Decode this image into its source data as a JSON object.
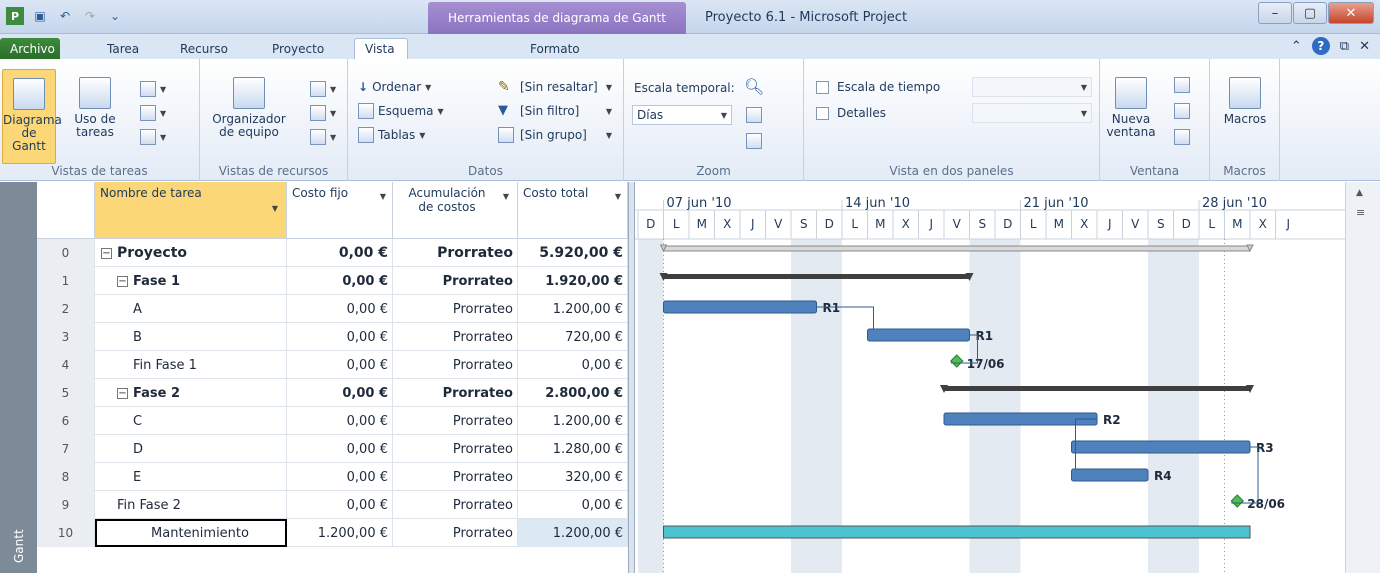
{
  "window": {
    "context_tab": "Herramientas de diagrama de Gantt",
    "title": "Proyecto 6.1  -  Microsoft Project"
  },
  "tabs": [
    {
      "label": "Archivo"
    },
    {
      "label": "Tarea"
    },
    {
      "label": "Recurso"
    },
    {
      "label": "Proyecto"
    },
    {
      "label": "Vista"
    },
    {
      "label": "Formato"
    }
  ],
  "ribbon": {
    "vistas_tareas": {
      "gantt": "Diagrama de Gantt",
      "uso": "Uso de tareas",
      "label": "Vistas de tareas"
    },
    "vistas_recursos": {
      "organizador": "Organizador de equipo",
      "label": "Vistas de recursos"
    },
    "datos": {
      "ordenar": "Ordenar",
      "esquema": "Esquema",
      "tablas": "Tablas",
      "resaltar": "[Sin resaltar]",
      "filtro": "[Sin filtro]",
      "grupo": "[Sin grupo]",
      "label": "Datos"
    },
    "zoom": {
      "escala_label": "Escala temporal:",
      "escala_value": "Días",
      "label": "Zoom"
    },
    "dos_paneles": {
      "escala_tiempo": "Escala de tiempo",
      "detalles": "Detalles",
      "label": "Vista en dos paneles"
    },
    "ventana": {
      "nueva": "Nueva ventana",
      "label": "Ventana"
    },
    "macros": {
      "macros": "Macros",
      "label": "Macros"
    }
  },
  "side_label": "Gantt",
  "table": {
    "headers": [
      "Nombre de tarea",
      "Costo fijo",
      "Acumulación de costos",
      "Costo total"
    ],
    "rows": [
      {
        "id": "0",
        "name": "Proyecto",
        "fixed": "0,00 €",
        "accrual": "Prorrateo",
        "total": "5.920,00 €"
      },
      {
        "id": "1",
        "name": "Fase 1",
        "fixed": "0,00 €",
        "accrual": "Prorrateo",
        "total": "1.920,00 €"
      },
      {
        "id": "2",
        "name": "A",
        "fixed": "0,00 €",
        "accrual": "Prorrateo",
        "total": "1.200,00 €"
      },
      {
        "id": "3",
        "name": "B",
        "fixed": "0,00 €",
        "accrual": "Prorrateo",
        "total": "720,00 €"
      },
      {
        "id": "4",
        "name": "Fin Fase 1",
        "fixed": "0,00 €",
        "accrual": "Prorrateo",
        "total": "0,00 €"
      },
      {
        "id": "5",
        "name": "Fase 2",
        "fixed": "0,00 €",
        "accrual": "Prorrateo",
        "total": "2.800,00 €"
      },
      {
        "id": "6",
        "name": "C",
        "fixed": "0,00 €",
        "accrual": "Prorrateo",
        "total": "1.200,00 €"
      },
      {
        "id": "7",
        "name": "D",
        "fixed": "0,00 €",
        "accrual": "Prorrateo",
        "total": "1.280,00 €"
      },
      {
        "id": "8",
        "name": "E",
        "fixed": "0,00 €",
        "accrual": "Prorrateo",
        "total": "320,00 €"
      },
      {
        "id": "9",
        "name": "Fin Fase 2",
        "fixed": "0,00 €",
        "accrual": "Prorrateo",
        "total": "0,00 €"
      },
      {
        "id": "10",
        "name": "Mantenimiento",
        "fixed": "1.200,00 €",
        "accrual": "Prorrateo",
        "total": "1.200,00 €"
      }
    ]
  },
  "timescale": {
    "weeks": [
      "07 jun '10",
      "14 jun '10",
      "21 jun '10",
      "28 jun '10"
    ],
    "days": [
      "D",
      "L",
      "M",
      "X",
      "J",
      "V",
      "S",
      "D",
      "L",
      "M",
      "X",
      "J",
      "V",
      "S",
      "D",
      "L",
      "M",
      "X",
      "J",
      "V",
      "S",
      "D",
      "L",
      "M",
      "X",
      "J"
    ]
  },
  "gantt": {
    "bars": [
      {
        "row": 0,
        "start": 1,
        "end": 23,
        "kind": "summary-top"
      },
      {
        "row": 1,
        "start": 1,
        "end": 12,
        "kind": "summary"
      },
      {
        "row": 2,
        "start": 1,
        "end": 6,
        "kind": "task",
        "label": "R1"
      },
      {
        "row": 3,
        "start": 9,
        "end": 12,
        "kind": "task",
        "label": "R1"
      },
      {
        "row": 4,
        "start": 12,
        "end": 12,
        "kind": "milestone",
        "label": "17/06"
      },
      {
        "row": 5,
        "start": 12,
        "end": 23,
        "kind": "summary"
      },
      {
        "row": 6,
        "start": 12,
        "end": 17,
        "kind": "task",
        "label": "R2"
      },
      {
        "row": 7,
        "start": 17,
        "end": 23,
        "kind": "task",
        "label": "R3"
      },
      {
        "row": 8,
        "start": 17,
        "end": 19,
        "kind": "task",
        "label": "R4"
      },
      {
        "row": 9,
        "start": 23,
        "end": 23,
        "kind": "milestone",
        "label": "28/06"
      },
      {
        "row": 10,
        "start": 1,
        "end": 23,
        "kind": "maintenance"
      }
    ],
    "colors": {
      "task": "#4f81bd",
      "summary": "#3f3f3f",
      "milestone": "#4ec04e",
      "maintenance": "#4cc3d0",
      "weekend": "#e4eaf2"
    }
  }
}
